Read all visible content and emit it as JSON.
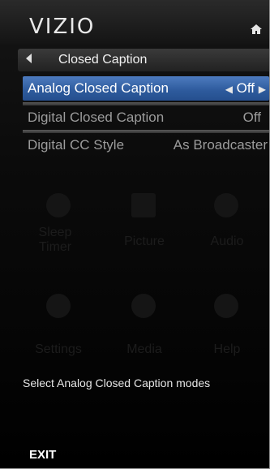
{
  "brand": {
    "logo": "VIZIO"
  },
  "breadcrumb": {
    "title": "Closed Caption"
  },
  "menu": {
    "items": [
      {
        "label": "Analog Closed Caption",
        "value": "Off",
        "selected": true
      },
      {
        "label": "Digital Closed Caption",
        "value": "Off",
        "selected": false
      },
      {
        "label": "Digital CC Style",
        "value": "As Broadcaster",
        "selected": false
      }
    ]
  },
  "background_apps": [
    {
      "label": "Sleep Timer"
    },
    {
      "label": "Picture"
    },
    {
      "label": "Audio"
    },
    {
      "label": "Settings"
    },
    {
      "label": "Media"
    },
    {
      "label": "Help"
    }
  ],
  "help_text": "Select Analog Closed Caption modes",
  "footer": {
    "exit_label": "EXIT"
  },
  "colors": {
    "selected_row": "#2d5a9c",
    "text_dim": "#9c9c9c"
  }
}
